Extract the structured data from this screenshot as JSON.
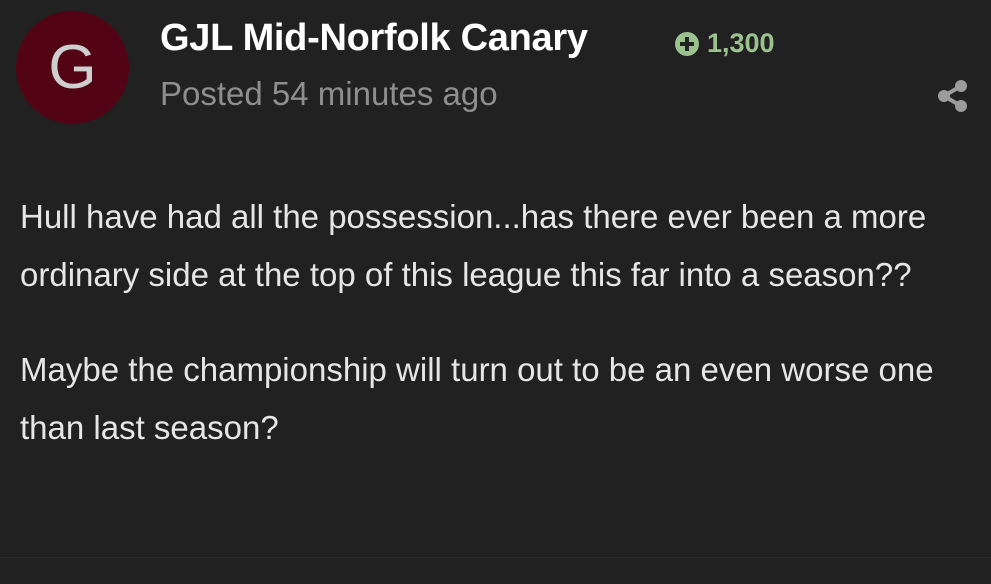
{
  "post": {
    "avatar_letter": "G",
    "author": "GJL Mid-Norfolk Canary",
    "reputation": "1,300",
    "posted": "Posted 54 minutes ago",
    "paragraphs": [
      "Hull have had all the possession...has there ever been a more ordinary side at the top of this league this far into a season??",
      "Maybe the championship will turn out to be an even worse one than last season?"
    ]
  },
  "icons": {
    "reputation": "plus-circle-icon",
    "share": "share-icon"
  },
  "colors": {
    "background": "#212121",
    "avatar": "#520414",
    "reputation": "#9bc18f",
    "muted_text": "#8e8e8e"
  }
}
